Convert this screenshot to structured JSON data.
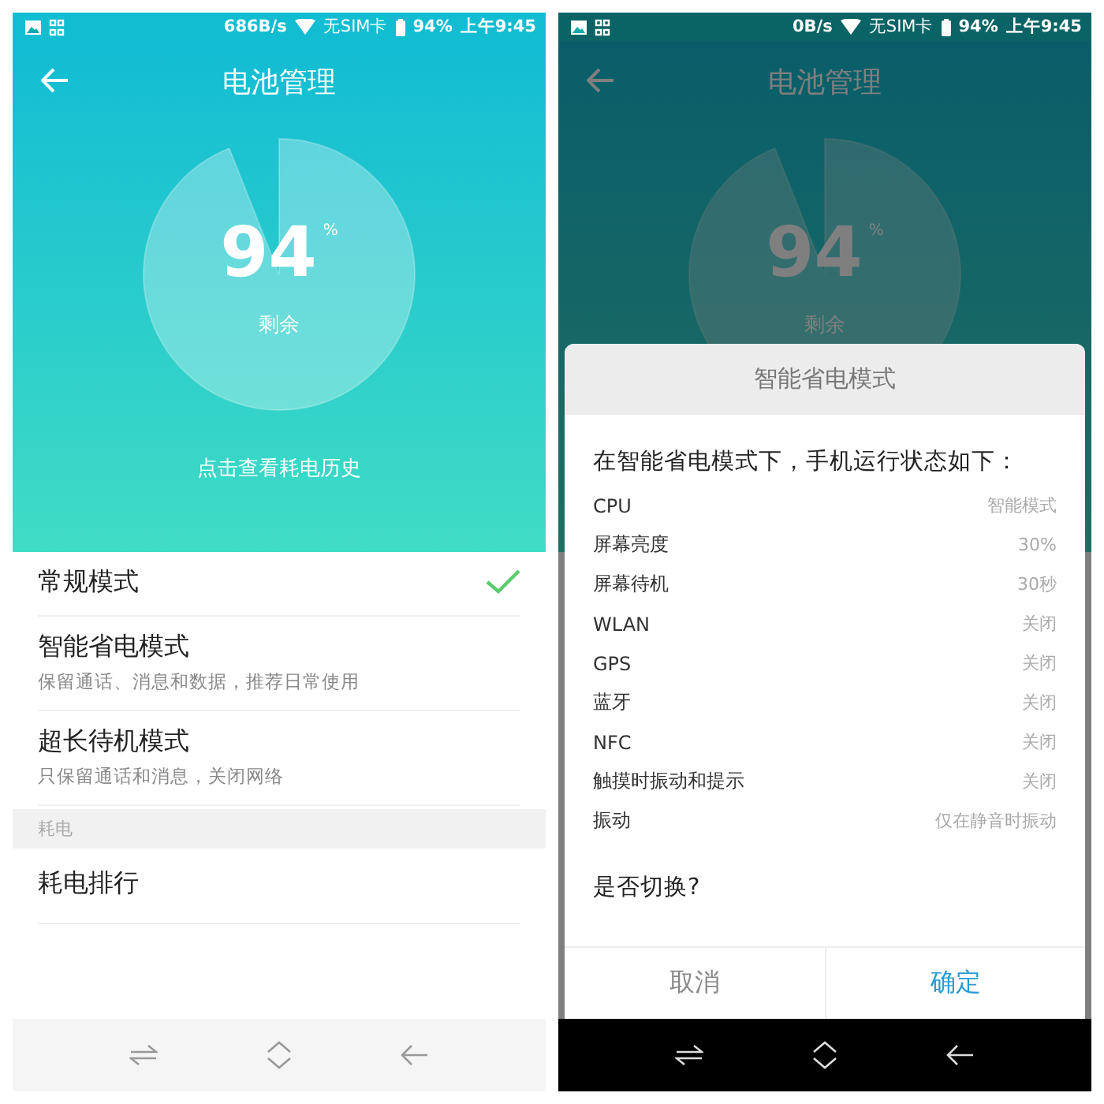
{
  "screens": [
    {
      "dimmed": false,
      "status_bar": {
        "speed": "686B/s",
        "carrier": "无SIM卡",
        "battery": "94%",
        "time": "上午9:45"
      },
      "title": "电池管理",
      "gauge": {
        "value": "94",
        "unit": "%",
        "caption": "剩余",
        "level": 0.94
      },
      "history_link": "点击查看耗电历史",
      "modes": [
        {
          "title": "常规模式",
          "selected": true
        },
        {
          "title": "智能省电模式",
          "description": "保留通话、消息和数据，推荐日常使用",
          "selected": false
        },
        {
          "title": "超长待机模式",
          "description": "只保留通话和消息，关闭网络",
          "selected": false
        }
      ],
      "section_header": "耗电",
      "items": [
        "耗电排行"
      ]
    },
    {
      "dimmed": true,
      "status_bar": {
        "speed": "0B/s",
        "carrier": "无SIM卡",
        "battery": "94%",
        "time": "上午9:45"
      },
      "title": "电池管理",
      "gauge": {
        "value": "94",
        "unit": "%",
        "caption": "剩余",
        "level": 0.94
      },
      "dialog": {
        "title": "智能省电模式",
        "intro": "在智能省电模式下，手机运行状态如下：",
        "settings": [
          {
            "name": "CPU",
            "value": "智能模式"
          },
          {
            "name": "屏幕亮度",
            "value": "30%"
          },
          {
            "name": "屏幕待机",
            "value": "30秒"
          },
          {
            "name": "WLAN",
            "value": "关闭"
          },
          {
            "name": "GPS",
            "value": "关闭"
          },
          {
            "name": "蓝牙",
            "value": "关闭"
          },
          {
            "name": "NFC",
            "value": "关闭"
          },
          {
            "name": "触摸时振动和提示",
            "value": "关闭"
          },
          {
            "name": "振动",
            "value": "仅在静音时振动"
          }
        ],
        "question": "是否切换?",
        "buttons": [
          {
            "label": "取消",
            "kind": "cancel"
          },
          {
            "label": "确定",
            "kind": "confirm"
          }
        ]
      }
    }
  ]
}
